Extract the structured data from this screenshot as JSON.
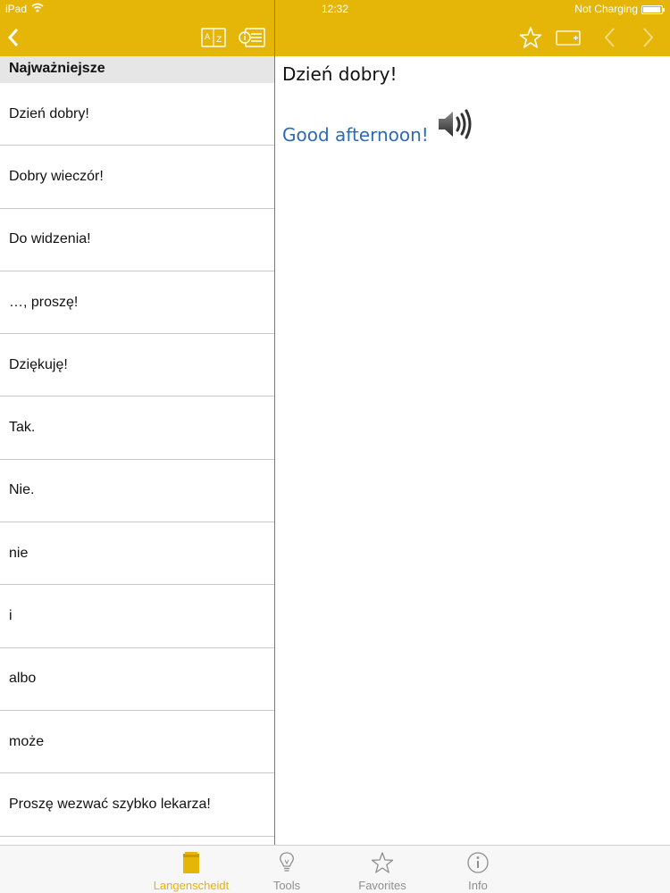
{
  "status_bar": {
    "carrier": "iPad",
    "time": "12:32",
    "battery_text": "Not Charging",
    "battery_level": 0.95
  },
  "left_nav": {
    "back_icon": "chevron-left-icon",
    "sort_icon": "az-sort-icon",
    "list_icon": "info-list-icon"
  },
  "right_nav": {
    "favorite_icon": "star-icon",
    "add_card_icon": "add-card-icon",
    "prev_icon": "chevron-left-icon",
    "next_icon": "chevron-right-icon"
  },
  "section": {
    "title": "Najważniejsze"
  },
  "list_items": [
    "Dzień dobry!",
    "Dobry wieczór!",
    "Do widzenia!",
    "…, proszę!",
    "Dziękuję!",
    "Tak.",
    "Nie.",
    "nie",
    "i",
    "albo",
    "może",
    "Proszę wezwać szybko lekarza!"
  ],
  "detail": {
    "phrase": "Dzień dobry!",
    "translation": "Good afternoon!",
    "audio_icon": "speaker-icon"
  },
  "tabs": [
    {
      "label": "Langenscheidt",
      "icon": "book-icon",
      "active": true
    },
    {
      "label": "Tools",
      "icon": "lightbulb-icon",
      "active": false
    },
    {
      "label": "Favorites",
      "icon": "star-icon",
      "active": false
    },
    {
      "label": "Info",
      "icon": "info-icon",
      "active": false
    }
  ],
  "colors": {
    "accent": "#e5b507",
    "link": "#2f6ab5"
  }
}
